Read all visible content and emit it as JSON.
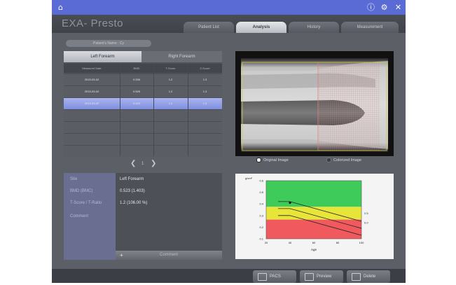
{
  "window": {
    "close_icon": "close-icon",
    "settings_icon": "gear-icon",
    "info_icon": "info-icon",
    "home_icon": "home-icon"
  },
  "app": {
    "title": "EXA- Presto"
  },
  "tabs": [
    "Patient List",
    "Analysis",
    "History",
    "Measurement"
  ],
  "patient_name": "Patient's Name : Cy",
  "forearm_tabs": {
    "left": "Left Forearm",
    "right": "Right Forearm"
  },
  "table": {
    "headers": [
      "Measured Date",
      "BMD",
      "T-Score",
      "Z-Score"
    ],
    "rows": [
      [
        "2015-03-02",
        "0.536",
        "1.2",
        "1.3"
      ],
      [
        "2015-03-02",
        "0.526",
        "1.2",
        "1.3"
      ],
      [
        "2015-03-02",
        "0.523",
        "1.2",
        "1.3"
      ]
    ]
  },
  "pager": {
    "prev": "❮",
    "index": "1",
    "next": "❯"
  },
  "info": {
    "site_label": "Site",
    "site_value": "Left Forearm",
    "bmd_label": "BMD (BMC)",
    "bmd_value": "0.523 (1.403)",
    "score_label": "T-Score / T-Ratio",
    "score_value": "1.2 (106.00 %)",
    "comment_label": "Comment",
    "comment_button": "Comment"
  },
  "image_options": {
    "original": "Original Image",
    "colorized": "Colorized Image"
  },
  "chart_data": {
    "type": "line",
    "ylabel": "g/cm²",
    "xlabel": "Age",
    "xlim": [
      20,
      100
    ],
    "ylim": [
      0.1,
      0.6
    ],
    "x_ticks": [
      20,
      40,
      60,
      80,
      100
    ],
    "y_ticks": [
      0.1,
      0.2,
      0.3,
      0.4,
      0.5,
      0.6
    ],
    "right_ticks": [
      "2.5",
      "0.0"
    ],
    "bands": [
      {
        "color": "#3fcb5a"
      },
      {
        "color": "#e8e53a"
      },
      {
        "color": "#f05a5f"
      }
    ],
    "series": [
      {
        "x": [
          30,
          40,
          100
        ],
        "y": [
          0.42,
          0.42,
          0.25
        ]
      },
      {
        "x": [
          30,
          40,
          100
        ],
        "y": [
          0.36,
          0.36,
          0.19
        ]
      },
      {
        "x": [
          30,
          40,
          100
        ],
        "y": [
          0.3,
          0.3,
          0.13
        ]
      }
    ],
    "points": [
      {
        "x": 40,
        "y": 0.41
      }
    ]
  },
  "bottom_buttons": [
    "PACS",
    "Preview",
    "Delete"
  ]
}
